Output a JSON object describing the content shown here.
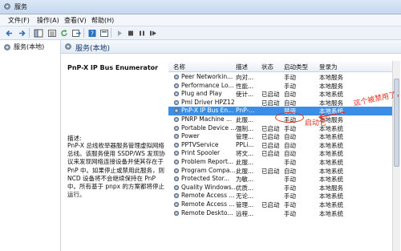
{
  "window": {
    "title": "服务"
  },
  "menu": [
    "文件(F)",
    "操作(A)",
    "查看(V)",
    "帮助(H)"
  ],
  "tree": {
    "node": "服务(本地)"
  },
  "header": {
    "title": "服务(本地)"
  },
  "description": {
    "service_name": "PnP-X IP Bus Enumerator",
    "label": "描述:",
    "text": "PnP-X 总线枚举器服务管理虚拟网络总线。该服务使用 SSDP/WS 发现协议来发现网络连接设备并使其存在于 PnP 中。如果停止或禁用此服务，则 NCD 设备将不会继续保持在 PnP 中。所有基于 pnpx 的方案都将停止运行。"
  },
  "columns": {
    "name": "名称",
    "desc": "描述",
    "status": "状态",
    "startup": "启动类型",
    "logon": "登录为"
  },
  "rows": [
    {
      "name": "Peer Networkin...",
      "desc": "向对...",
      "status": "",
      "startup": "手动",
      "logon": "本地服务"
    },
    {
      "name": "Performance Lo...",
      "desc": "性能...",
      "status": "",
      "startup": "手动",
      "logon": "本地服务"
    },
    {
      "name": "Plug and Play",
      "desc": "使计...",
      "status": "已启动",
      "startup": "自动",
      "logon": "本地系统"
    },
    {
      "name": "Pml Driver HPZ12",
      "desc": "",
      "status": "已启动",
      "startup": "自动",
      "logon": "本地服务"
    },
    {
      "name": "PnP-X IP Bus En...",
      "desc": "PnP-...",
      "status": "",
      "startup": "禁用",
      "logon": "本地系统",
      "selected": true
    },
    {
      "name": "PNRP Machine ...",
      "desc": "此服...",
      "status": "",
      "startup": "手动",
      "logon": "本地服务"
    },
    {
      "name": "Portable Device ...",
      "desc": "强制...",
      "status": "已启动",
      "startup": "手动",
      "logon": "本地系统"
    },
    {
      "name": "Power",
      "desc": "管理...",
      "status": "已启动",
      "startup": "自动",
      "logon": "本地系统"
    },
    {
      "name": "PPTVService",
      "desc": "PPLi...",
      "status": "已启动",
      "startup": "自动",
      "logon": "本地系统"
    },
    {
      "name": "Print Spooler",
      "desc": "将文...",
      "status": "已启动",
      "startup": "自动",
      "logon": "本地系统"
    },
    {
      "name": "Problem Report...",
      "desc": "此服...",
      "status": "",
      "startup": "手动",
      "logon": "本地系统"
    },
    {
      "name": "Program Compa...",
      "desc": "此服...",
      "status": "已启动",
      "startup": "自动",
      "logon": "本地系统"
    },
    {
      "name": "Protected Stor...",
      "desc": "为敏...",
      "status": "",
      "startup": "手动",
      "logon": "本地系统"
    },
    {
      "name": "Quality Windows...",
      "desc": "优质...",
      "status": "",
      "startup": "手动",
      "logon": "本地服务"
    },
    {
      "name": "Remote Access ...",
      "desc": "无论...",
      "status": "",
      "startup": "手动",
      "logon": "本地系统"
    },
    {
      "name": "Remote Access ...",
      "desc": "管理...",
      "status": "已启动",
      "startup": "手动",
      "logon": "本地系统"
    },
    {
      "name": "Remote Deskto...",
      "desc": "远程...",
      "status": "",
      "startup": "手动",
      "logon": "本地系统"
    }
  ],
  "annotations": {
    "line1": "这个被禁用了，",
    "line2": "启动它"
  },
  "colors": {
    "selection": "#3a8ee6",
    "annotation": "#e0301e"
  }
}
